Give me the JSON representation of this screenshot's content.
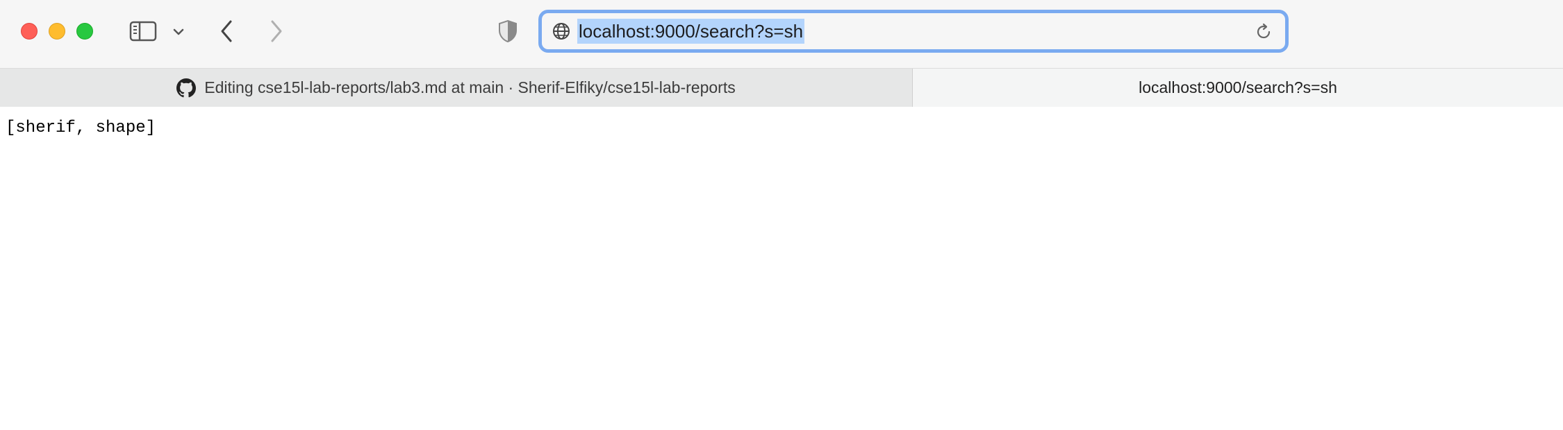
{
  "toolbar": {
    "address_bar": {
      "url": "localhost:9000/search?s=sh"
    }
  },
  "tabs": [
    {
      "label": "Editing cse15l-lab-reports/lab3.md at main · Sherif-Elfiky/cse15l-lab-reports",
      "icon": "github-icon",
      "active": false
    },
    {
      "label": "localhost:9000/search?s=sh",
      "active": true
    }
  ],
  "page": {
    "body_text": "[sherif, shape]"
  },
  "colors": {
    "close": "#fe5f57",
    "minimize": "#febc2e",
    "maximize": "#28c840",
    "focus_ring": "#7aaaf0",
    "selection": "#b3d4fc"
  }
}
